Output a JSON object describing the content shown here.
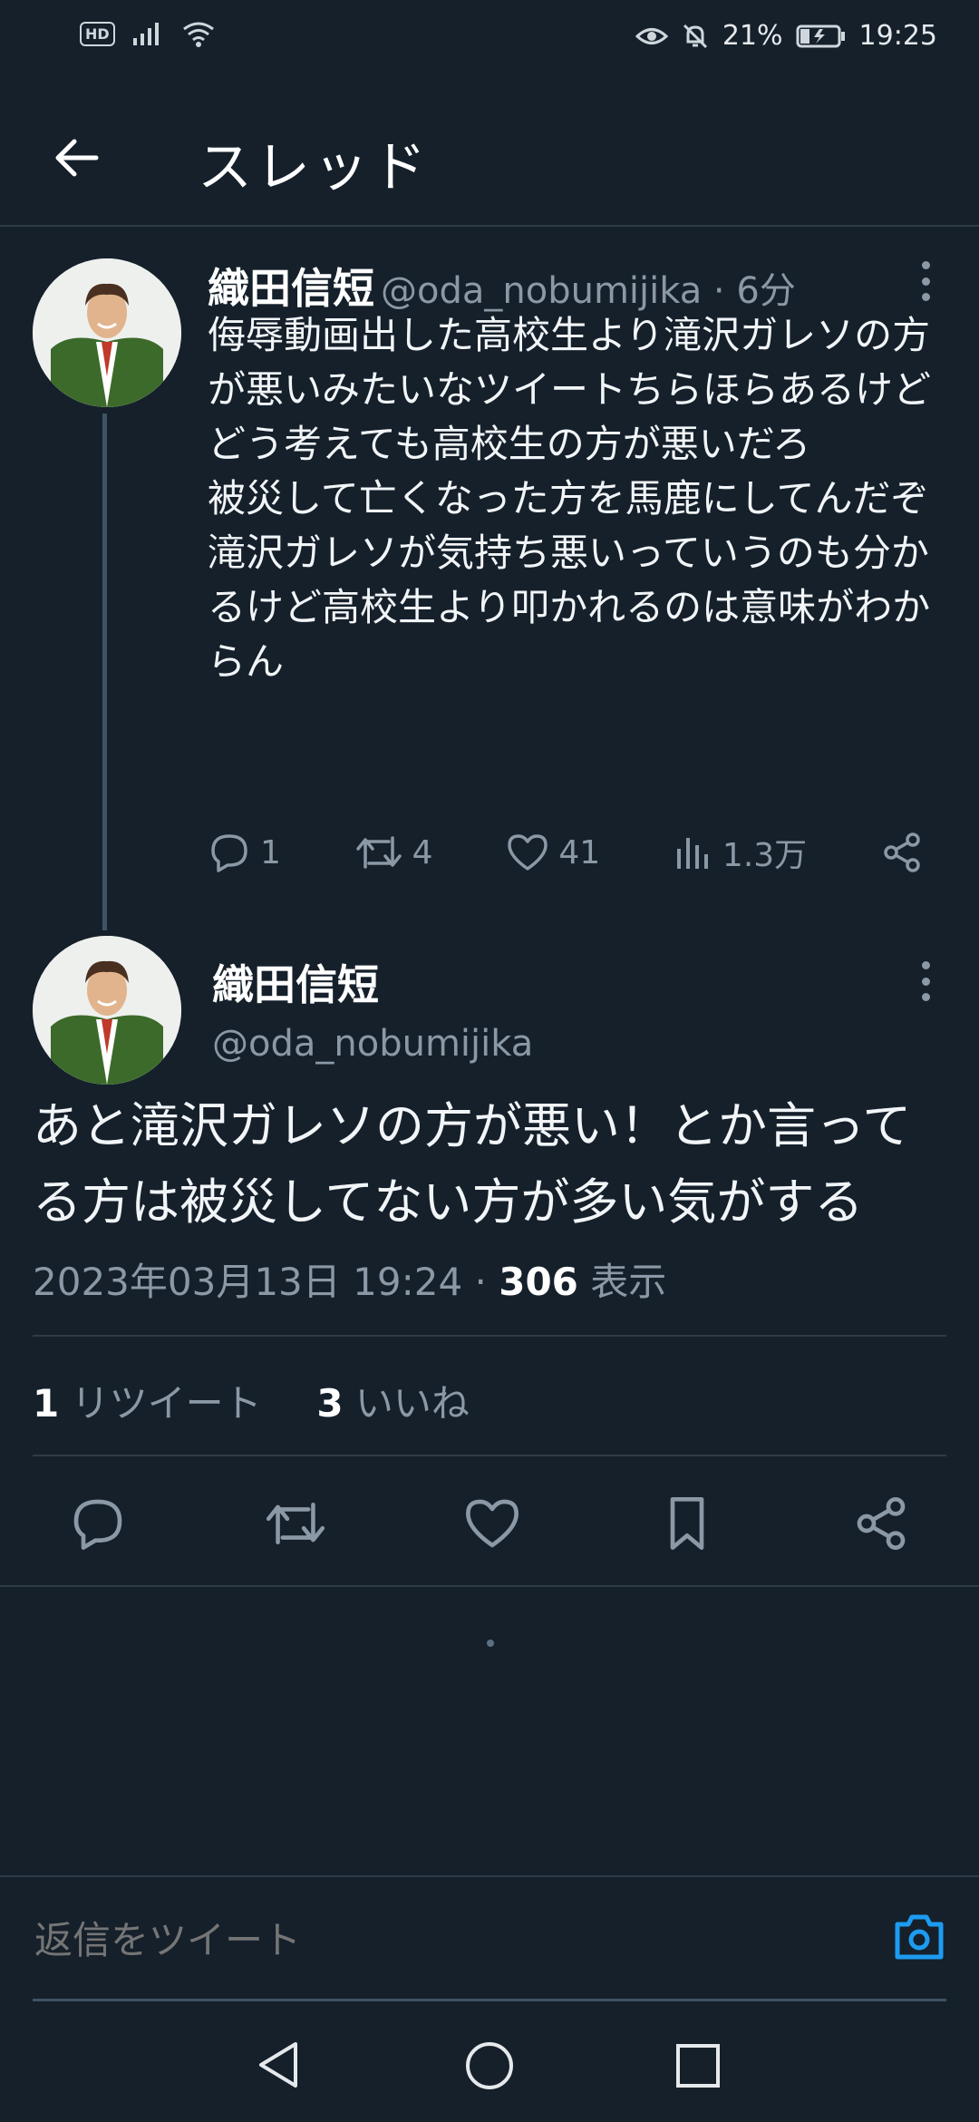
{
  "status_bar": {
    "hd_label": "HD",
    "battery": "21%",
    "time": "19:25"
  },
  "header": {
    "title": "スレッド"
  },
  "tweets": [
    {
      "name": "織田信短",
      "handle_time": "@oda_nobumijika · 6分",
      "text": "侮辱動画出した高校生より滝沢ガレソの方が悪いみたいなツイートちらほらあるけど\nどう考えても高校生の方が悪いだろ\n被災して亡くなった方を馬鹿にしてんだぞ\n滝沢ガレソが気持ち悪いっていうのも分かるけど高校生より叩かれるのは意味がわからん",
      "replies": "1",
      "retweets": "4",
      "likes": "41",
      "views": "1.3万"
    },
    {
      "name": "織田信短",
      "handle": "@oda_nobumijika",
      "text": "あと滝沢ガレソの方が悪い！とか言ってる方は被災してない方が多い気がする",
      "datetime": "2023年03月13日 19:24 · ",
      "views_count": "306",
      "views_label": " 表示",
      "retweet_count": "1",
      "retweet_label": " リツイート",
      "like_count": "3",
      "like_label": " いいね"
    }
  ],
  "reply_box": {
    "placeholder": "返信をツイート"
  },
  "colors": {
    "background": "#15202b",
    "secondary_text": "#8b98a5",
    "accent": "#1d9bf0",
    "divider": "#2f3b47"
  }
}
